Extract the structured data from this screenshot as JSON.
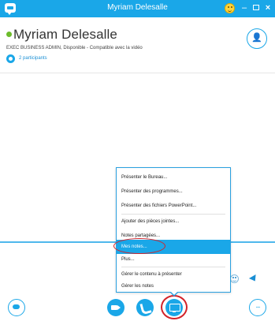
{
  "window": {
    "title": "Myriam Delesalle",
    "minimize": "–",
    "close": "×"
  },
  "contact": {
    "name": "Myriam Delesalle",
    "status": "EXEC BUSINESS ADMIN, Disponible - Compatible avec la vidéo",
    "participants": "2 participants",
    "add_icon": "+"
  },
  "toolbar": {
    "more": "..."
  },
  "menu": {
    "items": [
      "Présenter le Bureau...",
      "Présenter des programmes...",
      "Présenter des fichiers PowerPoint...",
      "Ajouter des pièces jointes...",
      "Notes partagées...",
      "Mes notes...",
      "Plus...",
      "Gérer le contenu à présenter",
      "Gérer les notes"
    ],
    "selected_index": 5
  },
  "colors": {
    "accent": "#1aa7e8",
    "highlight_circle": "#d3232a",
    "presence_available": "#6cbc2b"
  },
  "icons": {
    "app": "skype-chat-icon",
    "emoji": "smiley-icon",
    "add": "add-person-icon",
    "participants": "participants-icon",
    "chat": "chat-bubble-icon",
    "video": "video-camera-icon",
    "call": "phone-icon",
    "share": "screen-share-icon",
    "more": "more-options-icon",
    "send": "send-arrow-icon"
  }
}
